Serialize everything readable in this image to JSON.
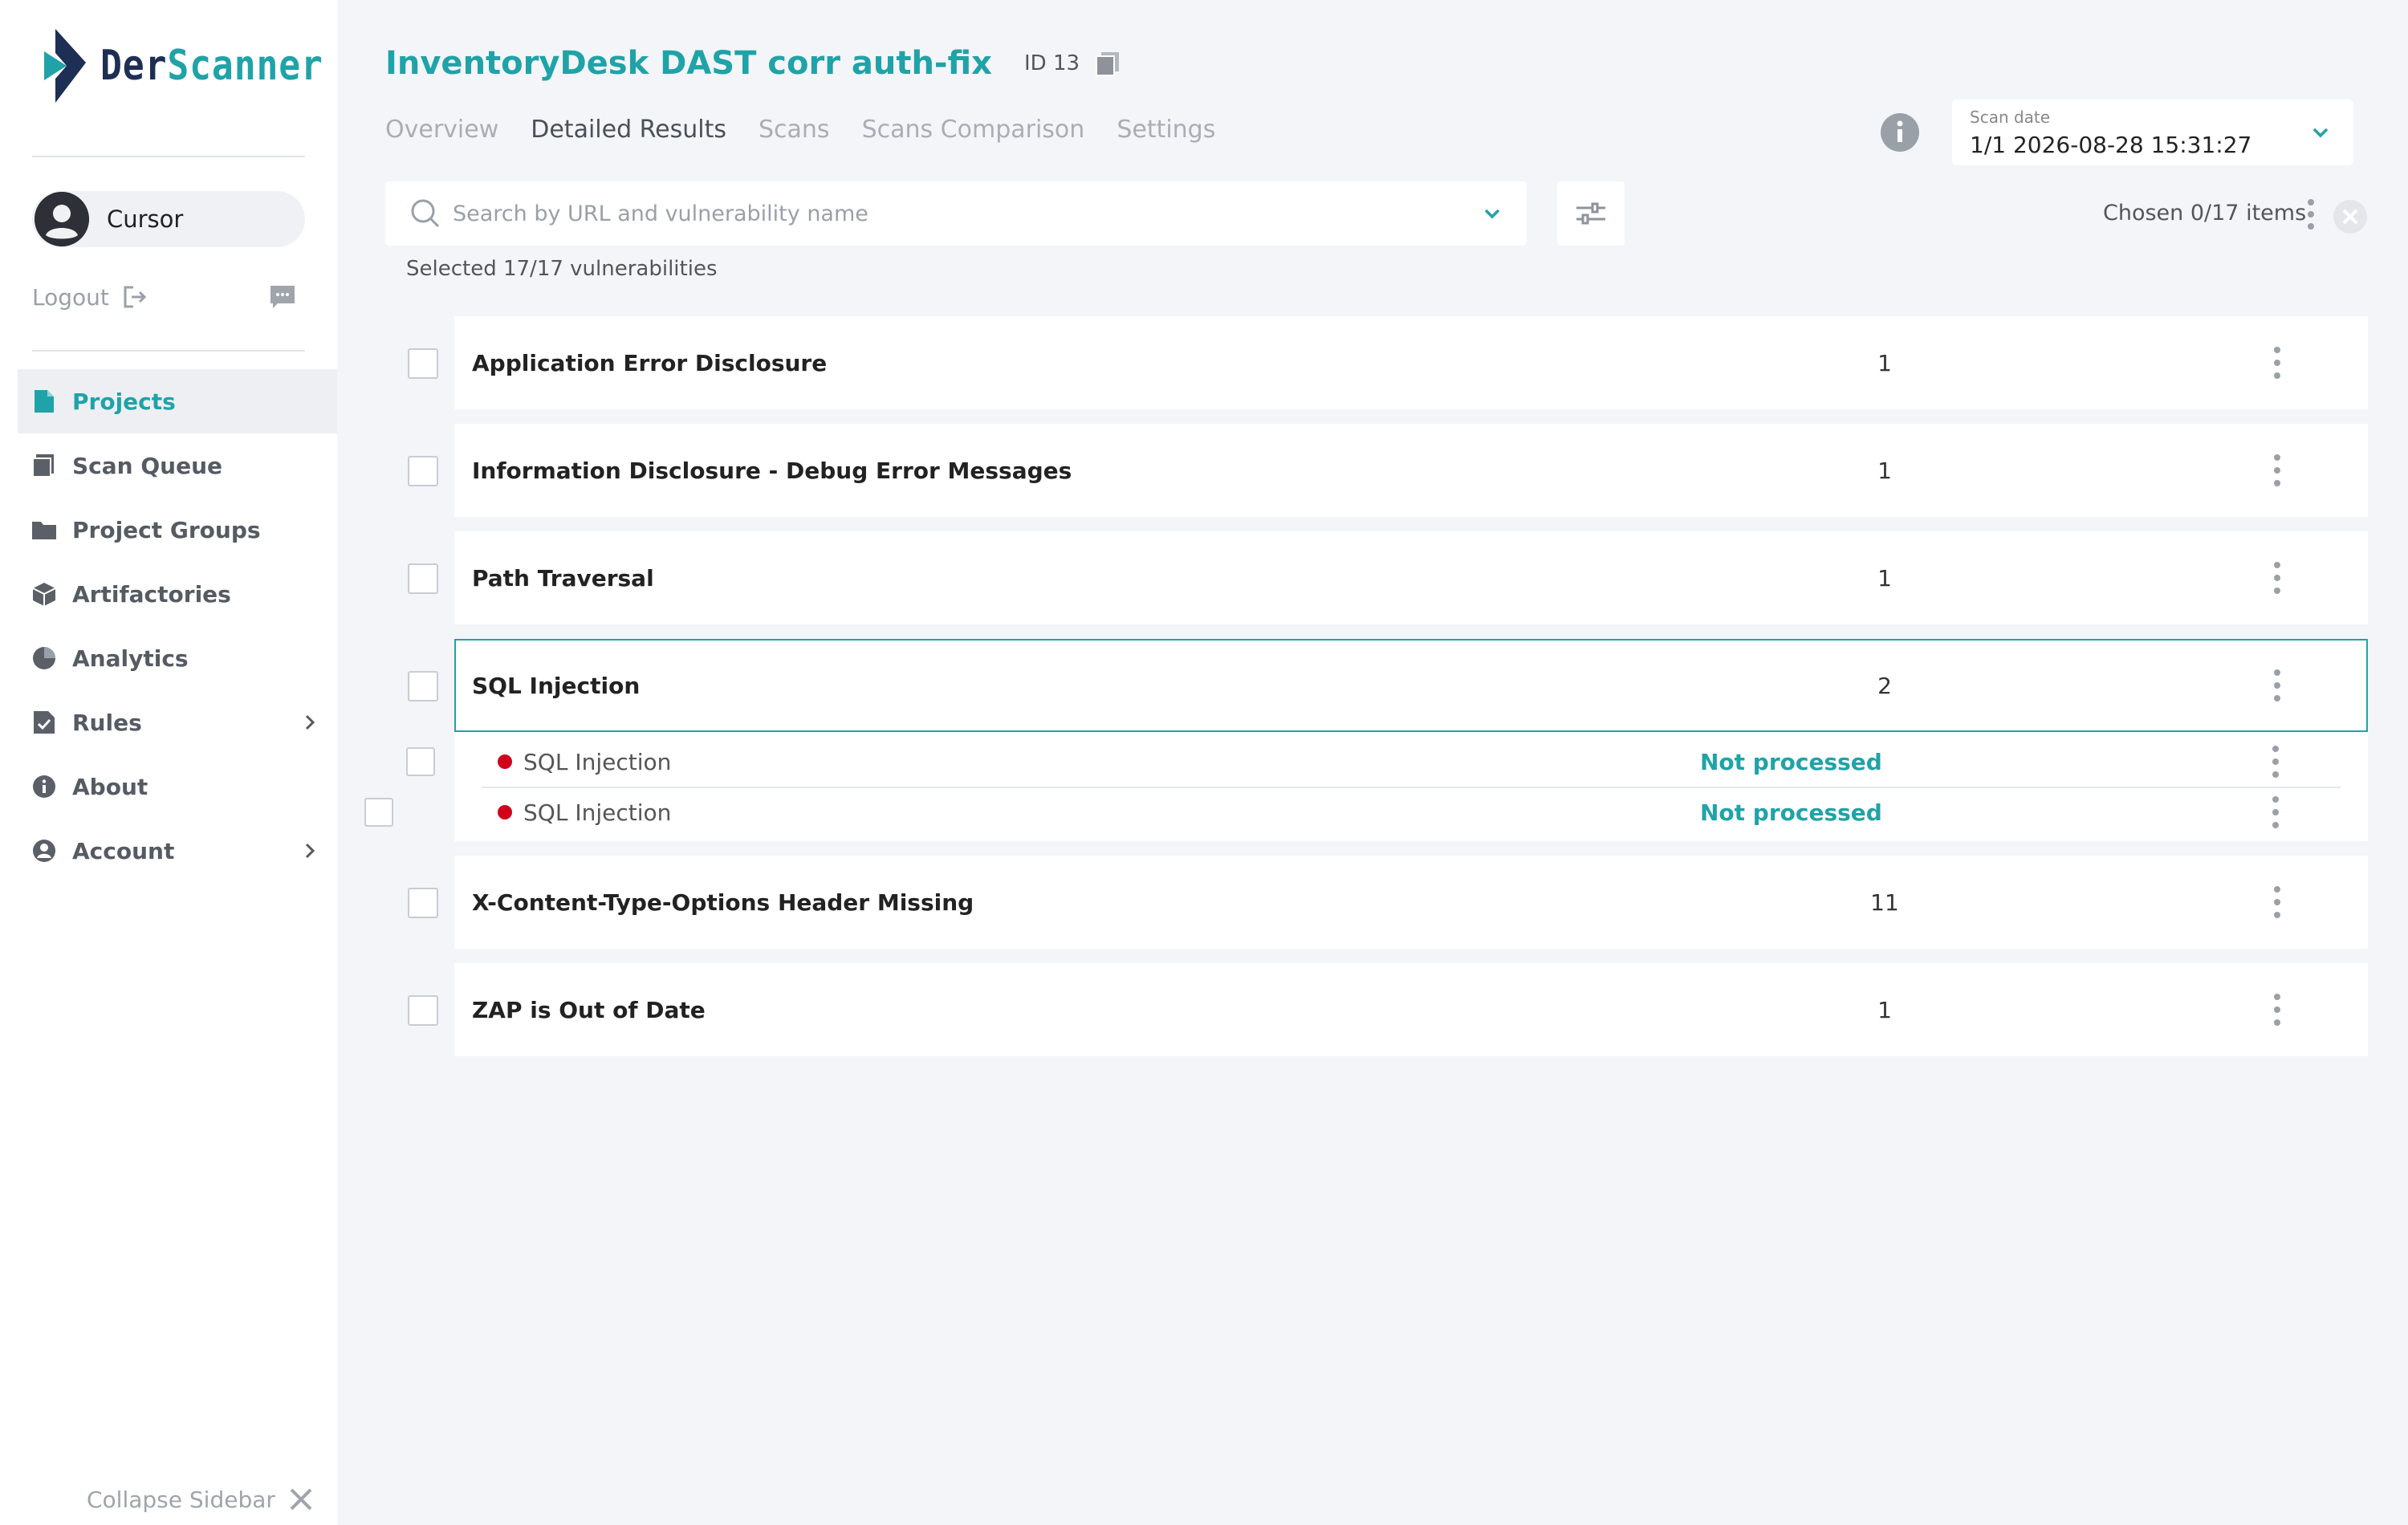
{
  "sidebar": {
    "logo": {
      "part1": "Der",
      "part2": "Scanner"
    },
    "user": {
      "name": "Cursor"
    },
    "logout_label": "Logout",
    "nav": [
      {
        "label": "Projects",
        "icon": "document-icon"
      },
      {
        "label": "Scan Queue",
        "icon": "queue-icon"
      },
      {
        "label": "Project Groups",
        "icon": "folder-icon"
      },
      {
        "label": "Artifactories",
        "icon": "cube-icon"
      },
      {
        "label": "Analytics",
        "icon": "pie-chart-icon"
      },
      {
        "label": "Rules",
        "icon": "checklist-icon"
      },
      {
        "label": "About",
        "icon": "info-icon"
      },
      {
        "label": "Account",
        "icon": "account-icon"
      }
    ],
    "collapse_label": "Collapse Sidebar"
  },
  "header": {
    "title": "InventoryDesk DAST corr auth-fix",
    "id_label": "ID 13",
    "tabs": [
      "Overview",
      "Detailed Results",
      "Scans",
      "Scans Comparison",
      "Settings"
    ],
    "active_tab": "Detailed Results",
    "scan_date_label": "Scan date",
    "scan_date_value": "1/1 2026-08-28 15:31:27"
  },
  "toolbar": {
    "search_placeholder": "Search by URL and vulnerability name",
    "chosen_label": "Chosen 0/17 items",
    "selected_label": "Selected 17/17 vulnerabilities"
  },
  "vulnerabilities": [
    {
      "name": "Application Error Disclosure",
      "count": "1"
    },
    {
      "name": "Information Disclosure - Debug Error Messages",
      "count": "1"
    },
    {
      "name": "Path Traversal",
      "count": "1"
    },
    {
      "name": "SQL Injection",
      "count": "2",
      "children": [
        {
          "name": "SQL Injection",
          "status": "Not processed"
        },
        {
          "name": "SQL Injection",
          "status": "Not processed"
        }
      ]
    },
    {
      "name": "X-Content-Type-Options Header Missing",
      "count": "11"
    },
    {
      "name": "ZAP is Out of Date",
      "count": "1"
    }
  ],
  "colors": {
    "accent": "#1fa3a8",
    "brand_dark": "#1e2f55",
    "severity_high": "#d0021b",
    "background": "#f4f5f9"
  }
}
